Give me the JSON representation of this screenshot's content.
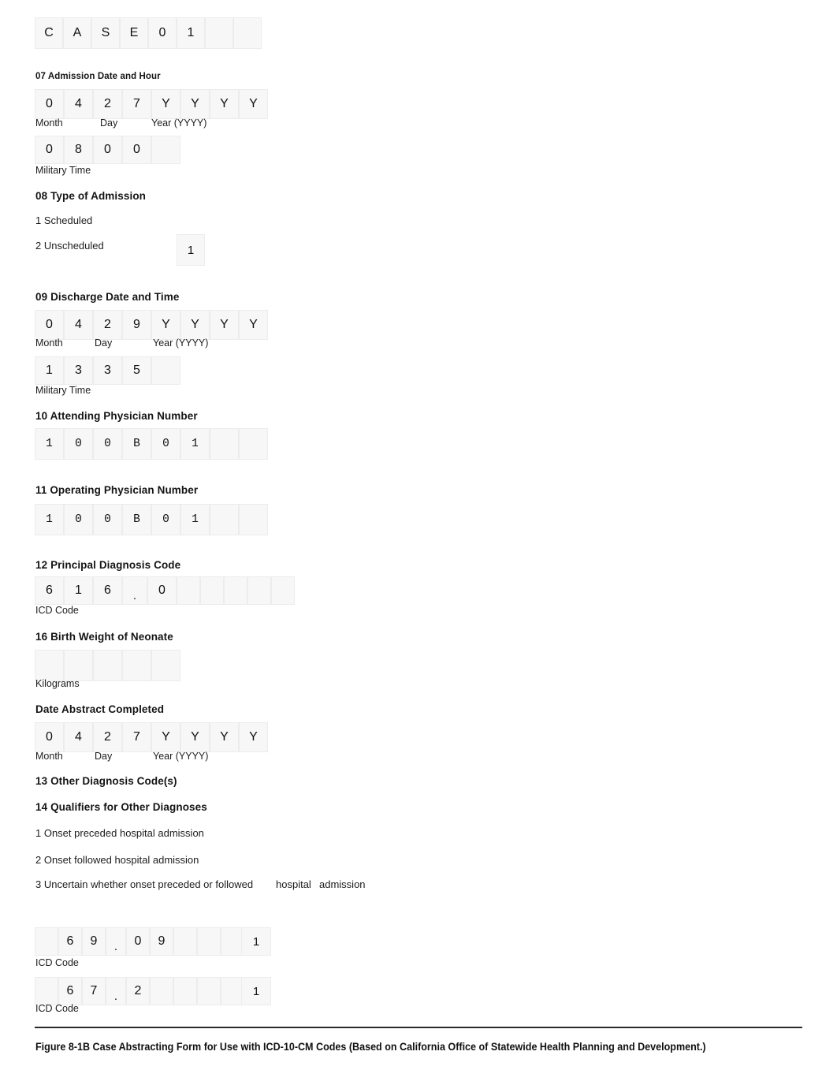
{
  "document": {
    "caption": "Figure 8-1B  Case Abstracting Form for Use with ICD-10-CM Codes (Based on California Office of Statewide Health Planning and Development.)"
  },
  "case_id": {
    "cells": [
      "C",
      "A",
      "S",
      "E",
      "0",
      "1",
      "",
      ""
    ]
  },
  "field_07": {
    "heading": "07 Admission Date and Hour",
    "date_cells": [
      "0",
      "4",
      "2",
      "7",
      "Y",
      "Y",
      "Y",
      "Y"
    ],
    "label_month": "Month",
    "label_day": "Day",
    "label_year": "Year (YYYY)",
    "time_cells": [
      "0",
      "8",
      "0",
      "0",
      ""
    ],
    "label_time": "Military Time"
  },
  "field_08": {
    "heading": "08 Type of Admission",
    "option_1": "1 Scheduled",
    "option_2": "2 Unscheduled",
    "answer": "1"
  },
  "field_09": {
    "heading": "09 Discharge Date and Time",
    "date_cells": [
      "0",
      "4",
      "2",
      "9",
      "Y",
      "Y",
      "Y",
      "Y"
    ],
    "label_month": "Month",
    "label_day": "Day",
    "label_year": "Year (YYYY)",
    "time_cells": [
      "1",
      "3",
      "3",
      "5",
      ""
    ],
    "label_time": "Military Time"
  },
  "field_10": {
    "heading": "10 Attending Physician Number",
    "cells": [
      "1",
      "0",
      "0",
      "B",
      "0",
      "1",
      "",
      ""
    ]
  },
  "field_11": {
    "heading": "11 Operating Physician Number",
    "cells": [
      "1",
      "0",
      "0",
      "B",
      "0",
      "1",
      "",
      ""
    ]
  },
  "field_12": {
    "heading": "12 Principal Diagnosis Code",
    "cells": [
      "6",
      "1",
      "6",
      ".",
      "0",
      "",
      "",
      "",
      "",
      ""
    ],
    "label": "ICD Code"
  },
  "field_16": {
    "heading": "16 Birth Weight of Neonate",
    "cells": [
      "",
      "",
      "",
      "",
      ""
    ],
    "label": "Kilograms"
  },
  "date_abstract": {
    "heading": "Date Abstract Completed",
    "date_cells": [
      "0",
      "4",
      "2",
      "7",
      "Y",
      "Y",
      "Y",
      "Y"
    ],
    "label_month": "Month",
    "label_day": "Day",
    "label_year": "Year (YYYY)"
  },
  "field_13": {
    "heading": "13 Other Diagnosis Code(s)"
  },
  "field_14": {
    "heading": "14 Qualifiers for Other Diagnoses",
    "option_1": "1 Onset preceded hospital admission",
    "option_2": "2 Onset followed hospital admission",
    "option_3a": "3 Uncertain whether onset preceded or followed",
    "option_3b": "hospital",
    "option_3c": "admission"
  },
  "other_diagnoses": {
    "label": "ICD Code",
    "rows": [
      {
        "cells": [
          "",
          "6",
          "9",
          ".",
          "0",
          "9",
          "",
          "",
          ""
        ],
        "qualifier": "1"
      },
      {
        "cells": [
          "",
          "6",
          "7",
          ".",
          "2",
          "",
          "",
          "",
          ""
        ],
        "qualifier": "1"
      }
    ]
  }
}
